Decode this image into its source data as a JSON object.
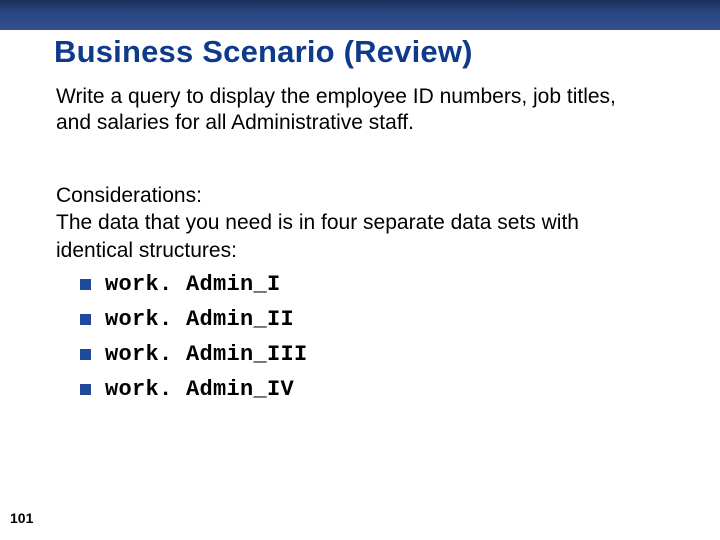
{
  "title": "Business Scenario (Review)",
  "intro": "Write a query to display the employee ID numbers, job titles, and salaries for all Administrative staff.",
  "considerations_label": "Considerations:",
  "considerations_text": "The data that you need is in four separate data sets with identical structures:",
  "bullets": {
    "0": "work. Admin_I",
    "1": "work. Admin_II",
    "2": "work. Admin_III",
    "3": "work. Admin_IV"
  },
  "slide_number": "101"
}
